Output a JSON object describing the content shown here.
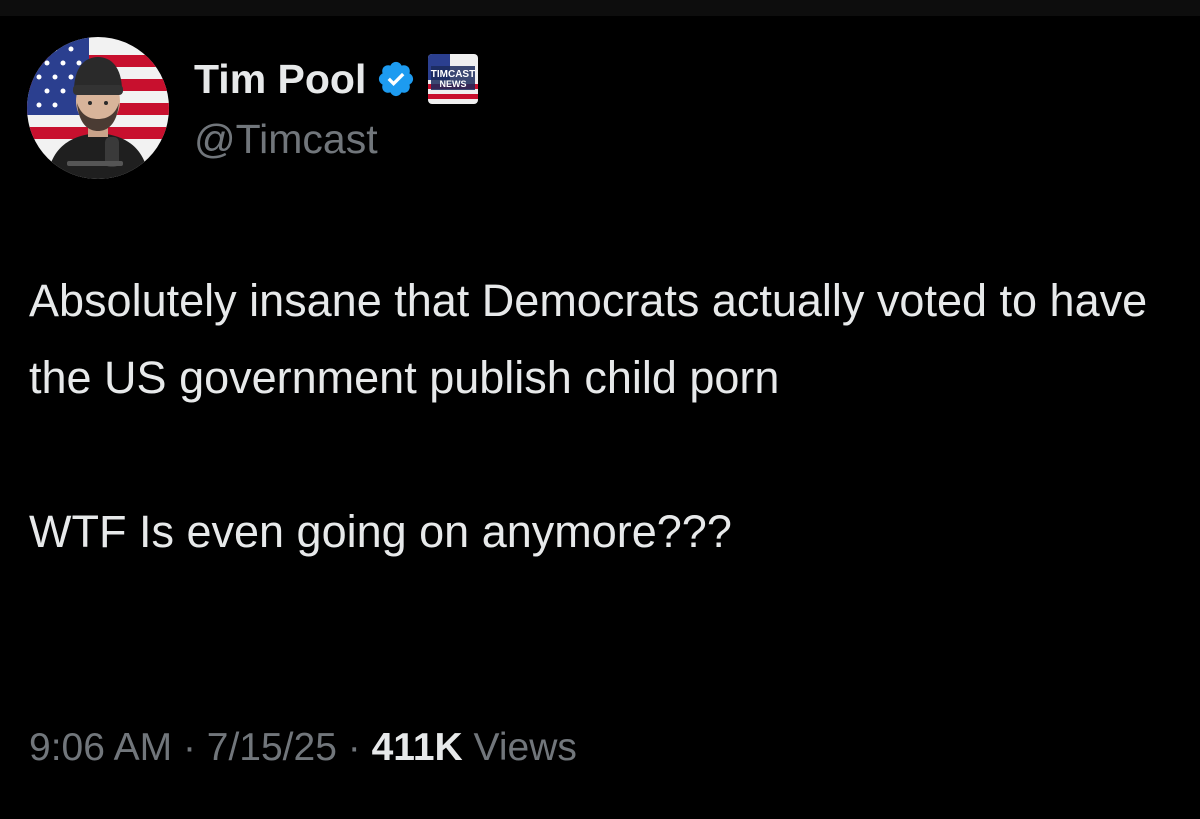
{
  "author": {
    "display_name": "Tim Pool",
    "handle": "@Timcast",
    "verified_color": "#1d9bf0",
    "affiliate_badge_text_line1": "TIMCAST",
    "affiliate_badge_text_line2": "NEWS",
    "avatar_icon": "profile-photo-flag-background"
  },
  "tweet": {
    "paragraph_1": "Absolutely insane that Democrats actually voted to have the US government publish child porn",
    "paragraph_2": "WTF Is even going on anymore???"
  },
  "meta": {
    "time": "9:06 AM",
    "separator": "·",
    "date": "7/15/25",
    "views_count": "411K",
    "views_label": "Views"
  },
  "colors": {
    "background": "#000000",
    "primary_text": "#e7e9ea",
    "secondary_text": "#71767b"
  }
}
